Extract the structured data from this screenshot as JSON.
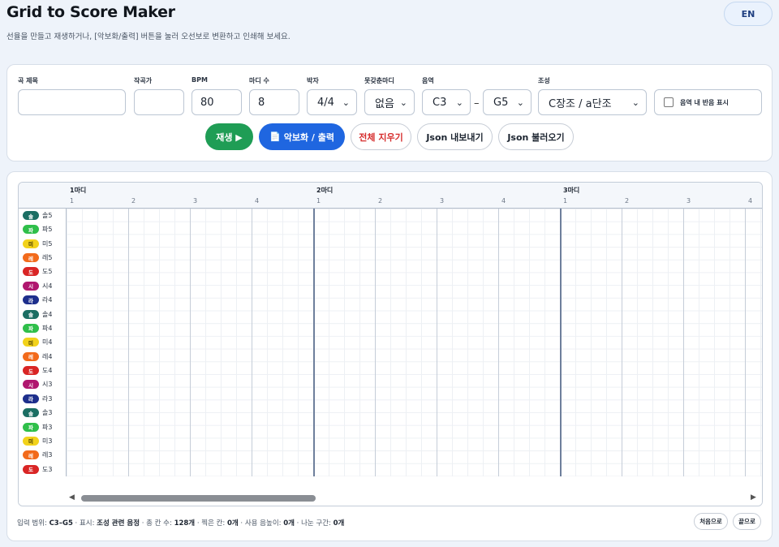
{
  "header": {
    "title": "Grid to Score Maker",
    "subtitle": "선율을 만들고 재생하거나, [악보화/출력] 버튼을 눌러 오선보로 변환하고 인쇄해 보세요.",
    "lang_button": "EN"
  },
  "controls": {
    "song_title_label": "곡 제목",
    "song_title_value": "",
    "composer_label": "작곡가",
    "composer_value": "",
    "bpm_label": "BPM",
    "bpm_value": "80",
    "measures_label": "마디 수",
    "measures_value": "8",
    "time_sig_label": "박자",
    "time_sig_value": "4/4",
    "pickup_label": "못갖춘마디",
    "pickup_value": "없음",
    "range_label": "음역",
    "range_low": "C3",
    "range_dash": "–",
    "range_high": "G5",
    "key_label": "조성",
    "key_value": "C장조 / a단조",
    "show_in_range_label": "음역 내 반음 표시",
    "play_button": "재생 ▶",
    "score_button": "악보화 / 출력",
    "clear_button": "전체 지우기",
    "export_button": "Json 내보내기",
    "import_button": "Json 불러오기"
  },
  "ruler": {
    "measures": [
      "1마디",
      "2마디",
      "3마디"
    ],
    "beats": [
      "1",
      "2",
      "3",
      "4",
      "1",
      "2",
      "3",
      "4",
      "1",
      "2",
      "3",
      "4"
    ]
  },
  "keys": [
    {
      "chip": "솔",
      "name": "솔5",
      "color": "#1b6e63"
    },
    {
      "chip": "파",
      "name": "파5",
      "color": "#2fbf4a"
    },
    {
      "chip": "미",
      "name": "미5",
      "color": "#f2d21b"
    },
    {
      "chip": "레",
      "name": "레5",
      "color": "#f26a1b"
    },
    {
      "chip": "도",
      "name": "도5",
      "color": "#d92525"
    },
    {
      "chip": "시",
      "name": "시4",
      "color": "#b0176f"
    },
    {
      "chip": "라",
      "name": "라4",
      "color": "#1e2f8c"
    },
    {
      "chip": "솔",
      "name": "솔4",
      "color": "#1b6e63"
    },
    {
      "chip": "파",
      "name": "파4",
      "color": "#2fbf4a"
    },
    {
      "chip": "미",
      "name": "미4",
      "color": "#f2d21b"
    },
    {
      "chip": "레",
      "name": "레4",
      "color": "#f26a1b"
    },
    {
      "chip": "도",
      "name": "도4",
      "color": "#d92525"
    },
    {
      "chip": "시",
      "name": "시3",
      "color": "#b0176f"
    },
    {
      "chip": "라",
      "name": "라3",
      "color": "#1e2f8c"
    },
    {
      "chip": "솔",
      "name": "솔3",
      "color": "#1b6e63"
    },
    {
      "chip": "파",
      "name": "파3",
      "color": "#2fbf4a"
    },
    {
      "chip": "미",
      "name": "미3",
      "color": "#f2d21b"
    },
    {
      "chip": "레",
      "name": "레3",
      "color": "#f26a1b"
    },
    {
      "chip": "도",
      "name": "도3",
      "color": "#d92525"
    }
  ],
  "status": {
    "range_label": "입력 범위: ",
    "range_value": "C3–G5",
    "display_label": " · 표시: ",
    "display_value": "조성 관련 음정",
    "total_label": " · 총 칸 수: ",
    "total_value": "128개",
    "filled_label": " · 찍은 칸: ",
    "filled_value": "0개",
    "notes_label": " · 사용 음높이: ",
    "notes_value": "0개",
    "split_label": " · 나눈 구간: ",
    "split_value": "0개"
  },
  "nav": {
    "first_button": "처음으로",
    "last_button": "끝으로"
  }
}
